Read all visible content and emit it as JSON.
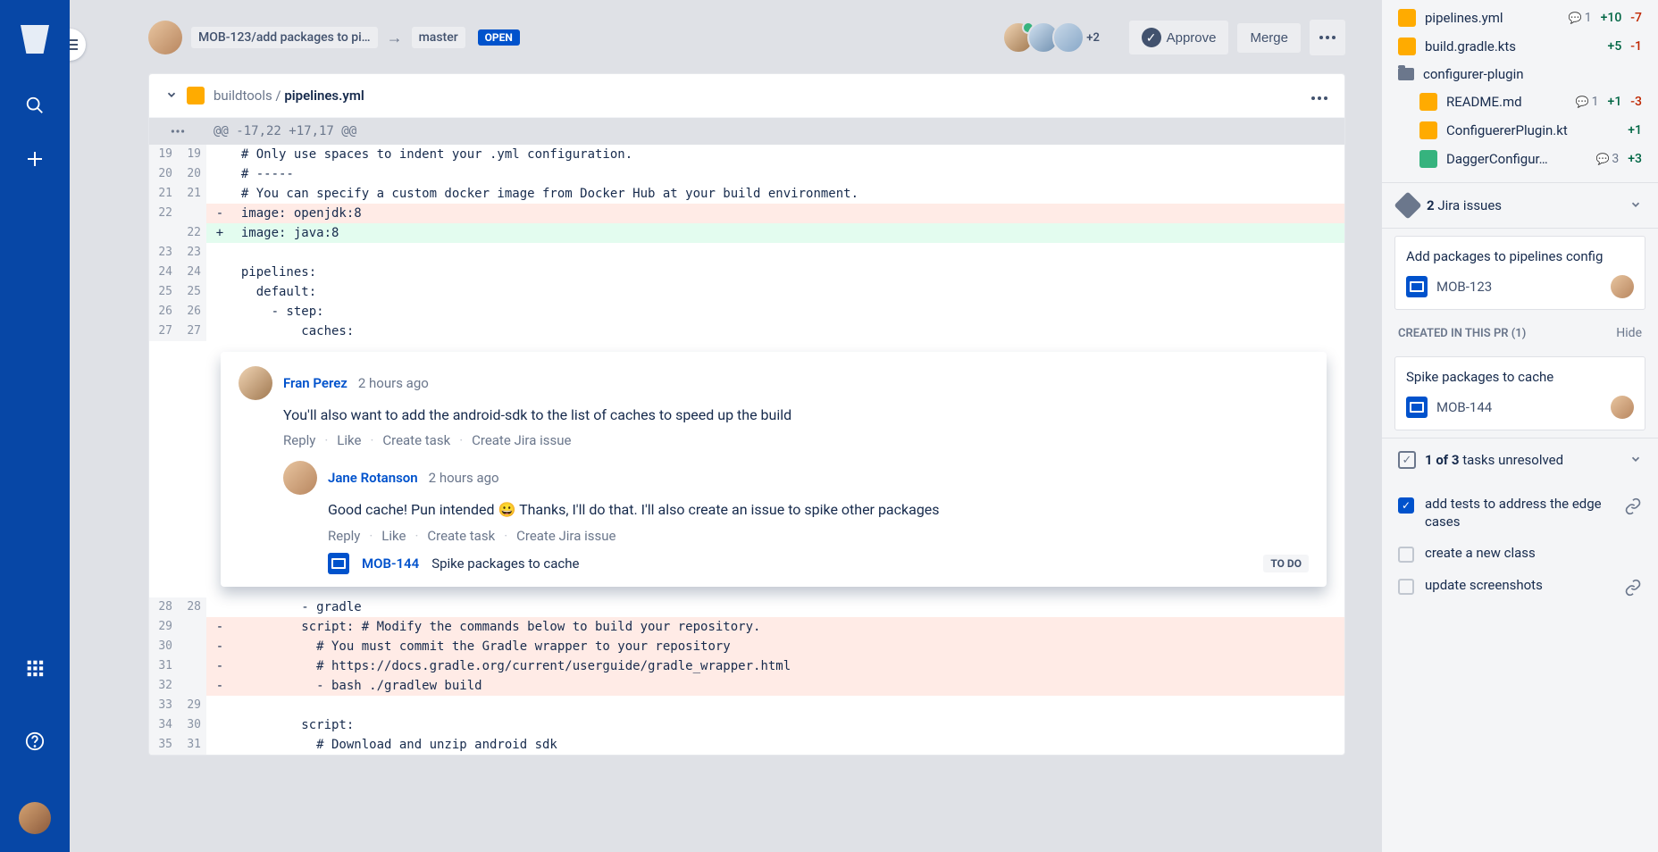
{
  "header": {
    "source_branch": "MOB-123/add packages to pi…",
    "target_branch": "master",
    "status": "OPEN",
    "extra_reviewers": "+2",
    "approve_label": "Approve",
    "merge_label": "Merge"
  },
  "file": {
    "path_prefix": "buildtools / ",
    "path_name": "pipelines.yml",
    "hunk_header": "@@ -17,22 +17,17 @@"
  },
  "lines": [
    {
      "o": "19",
      "n": "19",
      "t": "ctx",
      "c": "  # Only use spaces to indent your .yml configuration."
    },
    {
      "o": "20",
      "n": "20",
      "t": "ctx",
      "c": "  # -----"
    },
    {
      "o": "21",
      "n": "21",
      "t": "ctx",
      "c": "  # You can specify a custom docker image from Docker Hub at your build environment."
    },
    {
      "o": "22",
      "n": "",
      "t": "del",
      "c": "  image: openjdk:8"
    },
    {
      "o": "",
      "n": "22",
      "t": "add",
      "c": "  image: java:8"
    },
    {
      "o": "23",
      "n": "23",
      "t": "ctx",
      "c": ""
    },
    {
      "o": "24",
      "n": "24",
      "t": "ctx",
      "c": "  pipelines:"
    },
    {
      "o": "25",
      "n": "25",
      "t": "ctx",
      "c": "    default:"
    },
    {
      "o": "26",
      "n": "26",
      "t": "ctx",
      "c": "      - step:"
    },
    {
      "o": "27",
      "n": "27",
      "t": "ctx",
      "c": "          caches:"
    }
  ],
  "lines2": [
    {
      "o": "28",
      "n": "28",
      "t": "ctx",
      "c": "          - gradle"
    },
    {
      "o": "29",
      "n": "",
      "t": "del",
      "c": "          script: # Modify the commands below to build your repository."
    },
    {
      "o": "30",
      "n": "",
      "t": "del",
      "c": "            # You must commit the Gradle wrapper to your repository"
    },
    {
      "o": "31",
      "n": "",
      "t": "del",
      "c": "            # https://docs.gradle.org/current/userguide/gradle_wrapper.html"
    },
    {
      "o": "32",
      "n": "",
      "t": "del",
      "c": "            - bash ./gradlew build"
    },
    {
      "o": "33",
      "n": "29",
      "t": "ctx",
      "c": ""
    },
    {
      "o": "34",
      "n": "30",
      "t": "ctx",
      "c": "          script:"
    },
    {
      "o": "35",
      "n": "31",
      "t": "ctx",
      "c": "            # Download and unzip android sdk"
    }
  ],
  "comment1": {
    "author": "Fran Perez",
    "time": "2 hours ago",
    "body": "You'll also want to add the android-sdk to the list of caches to speed up the build",
    "actions": {
      "reply": "Reply",
      "like": "Like",
      "task": "Create task",
      "jira": "Create Jira issue"
    }
  },
  "comment2": {
    "author": "Jane Rotanson",
    "time": "2 hours ago",
    "body_a": "Good cache! Pun intended ",
    "body_b": " Thanks, I'll do that. I'll also create an issue to spike other packages",
    "actions": {
      "reply": "Reply",
      "like": "Like",
      "task": "Create task",
      "jira": "Create Jira issue"
    },
    "issue_key": "MOB-144",
    "issue_summary": "Spike packages to cache",
    "issue_status": "TO DO"
  },
  "rp_files": [
    {
      "type": "file",
      "badge": "mod",
      "name": "pipelines.yml",
      "comments": "1",
      "add": "+10",
      "del": "-7"
    },
    {
      "type": "file",
      "badge": "mod",
      "name": "build.gradle.kts",
      "comments": "",
      "add": "+5",
      "del": "-1"
    },
    {
      "type": "folder",
      "name": "configurer-plugin"
    },
    {
      "type": "file",
      "badge": "mod",
      "name": "README.md",
      "comments": "1",
      "add": "+1",
      "del": "-3",
      "indent": true
    },
    {
      "type": "file",
      "badge": "mod",
      "name": "ConfiguererPlugin.kt",
      "comments": "",
      "add": "+1",
      "del": "",
      "indent": true
    },
    {
      "type": "file",
      "badge": "add",
      "name": "DaggerConfigur…",
      "comments": "3",
      "add": "+3",
      "del": "",
      "indent": true
    }
  ],
  "jira_section": {
    "title_count": "2",
    "title_text": " Jira issues",
    "linked": {
      "summary": "Add packages to pipelines config",
      "key": "MOB-123"
    },
    "created_head": "CREATED IN THIS PR (1)",
    "hide": "Hide",
    "created": {
      "summary": "Spike packages to cache",
      "key": "MOB-144"
    }
  },
  "tasks_section": {
    "title_a": "1 of 3",
    "title_b": " tasks unresolved",
    "items": [
      {
        "checked": true,
        "label": "add tests to address the edge cases",
        "link": true
      },
      {
        "checked": false,
        "label": "create a new class",
        "link": false
      },
      {
        "checked": false,
        "label": "update screenshots",
        "link": true
      }
    ]
  }
}
